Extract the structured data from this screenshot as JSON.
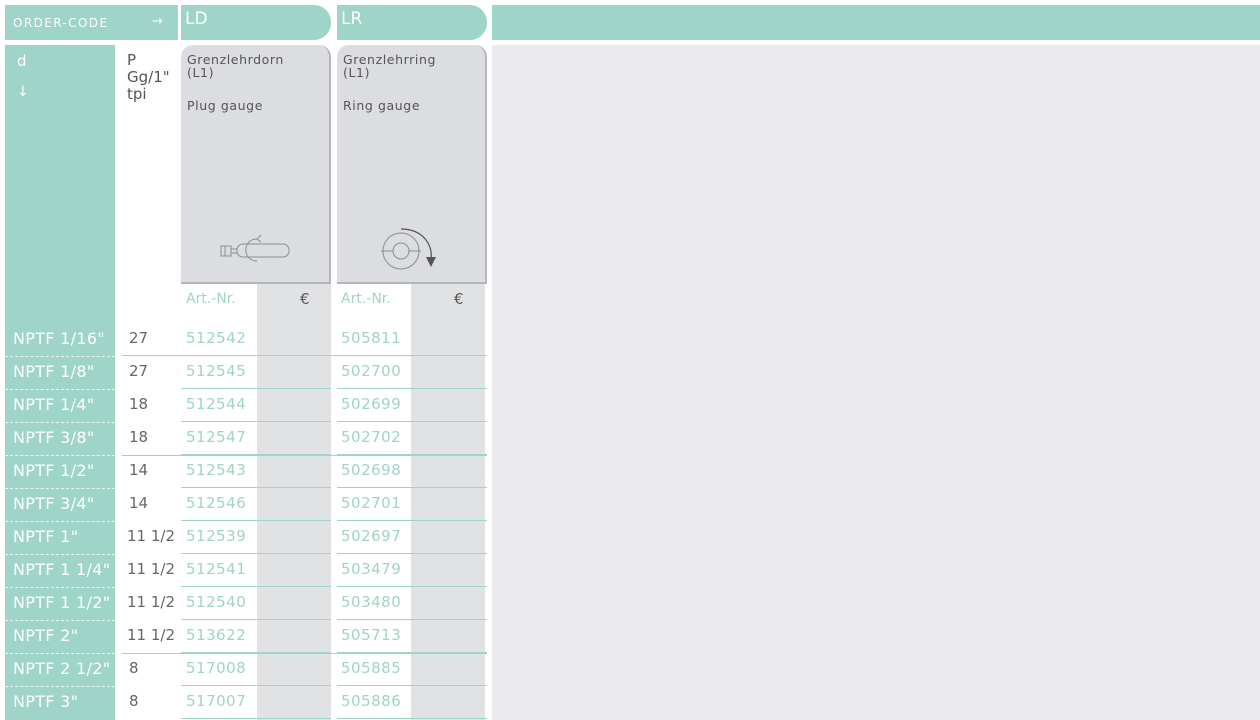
{
  "header": {
    "order_code": "ORDER-CODE",
    "order_arrow": "→",
    "ld": "LD",
    "lr": "LR"
  },
  "columns": {
    "d": "d",
    "d_arrow": "↓",
    "p_lines": [
      "P",
      "Gg/1\"",
      "tpi"
    ]
  },
  "products": [
    {
      "code": "LD",
      "name_de": "Grenzlehrdorn (L1)",
      "name_en": "Plug gauge",
      "icon": "plug-gauge-icon"
    },
    {
      "code": "LR",
      "name_de": "Grenzlehrring (L1)",
      "name_en": "Ring gauge",
      "icon": "ring-gauge-icon"
    }
  ],
  "subheader": {
    "art": "Art.-Nr.",
    "price": "€"
  },
  "rows": [
    {
      "d": "NPTF 1/16\"",
      "tpi": "27",
      "ld": "512542",
      "lr": "505811"
    },
    {
      "d": "NPTF 1/8\"",
      "tpi": "27",
      "ld": "512545",
      "lr": "502700"
    },
    {
      "d": "NPTF 1/4\"",
      "tpi": "18",
      "ld": "512544",
      "lr": "502699"
    },
    {
      "d": "NPTF 3/8\"",
      "tpi": "18",
      "ld": "512547",
      "lr": "502702"
    },
    {
      "d": "NPTF 1/2\"",
      "tpi": "14",
      "ld": "512543",
      "lr": "502698"
    },
    {
      "d": "NPTF 3/4\"",
      "tpi": "14",
      "ld": "512546",
      "lr": "502701"
    },
    {
      "d": "NPTF 1\"",
      "tpi": "11 1/2",
      "ld": "512539",
      "lr": "502697"
    },
    {
      "d": "NPTF 1 1/4\"",
      "tpi": "11 1/2",
      "ld": "512541",
      "lr": "503479"
    },
    {
      "d": "NPTF 1 1/2\"",
      "tpi": "11 1/2",
      "ld": "512540",
      "lr": "503480"
    },
    {
      "d": "NPTF 2\"",
      "tpi": "11 1/2",
      "ld": "513622",
      "lr": "505713"
    },
    {
      "d": "NPTF 2 1/2\"",
      "tpi": "8",
      "ld": "517008",
      "lr": "505885"
    },
    {
      "d": "NPTF 3\"",
      "tpi": "8",
      "ld": "517007",
      "lr": "505886"
    }
  ],
  "colors": {
    "teal": "#9fd4c8",
    "gray": "#e1e2e4",
    "panel": "#ebebed"
  }
}
